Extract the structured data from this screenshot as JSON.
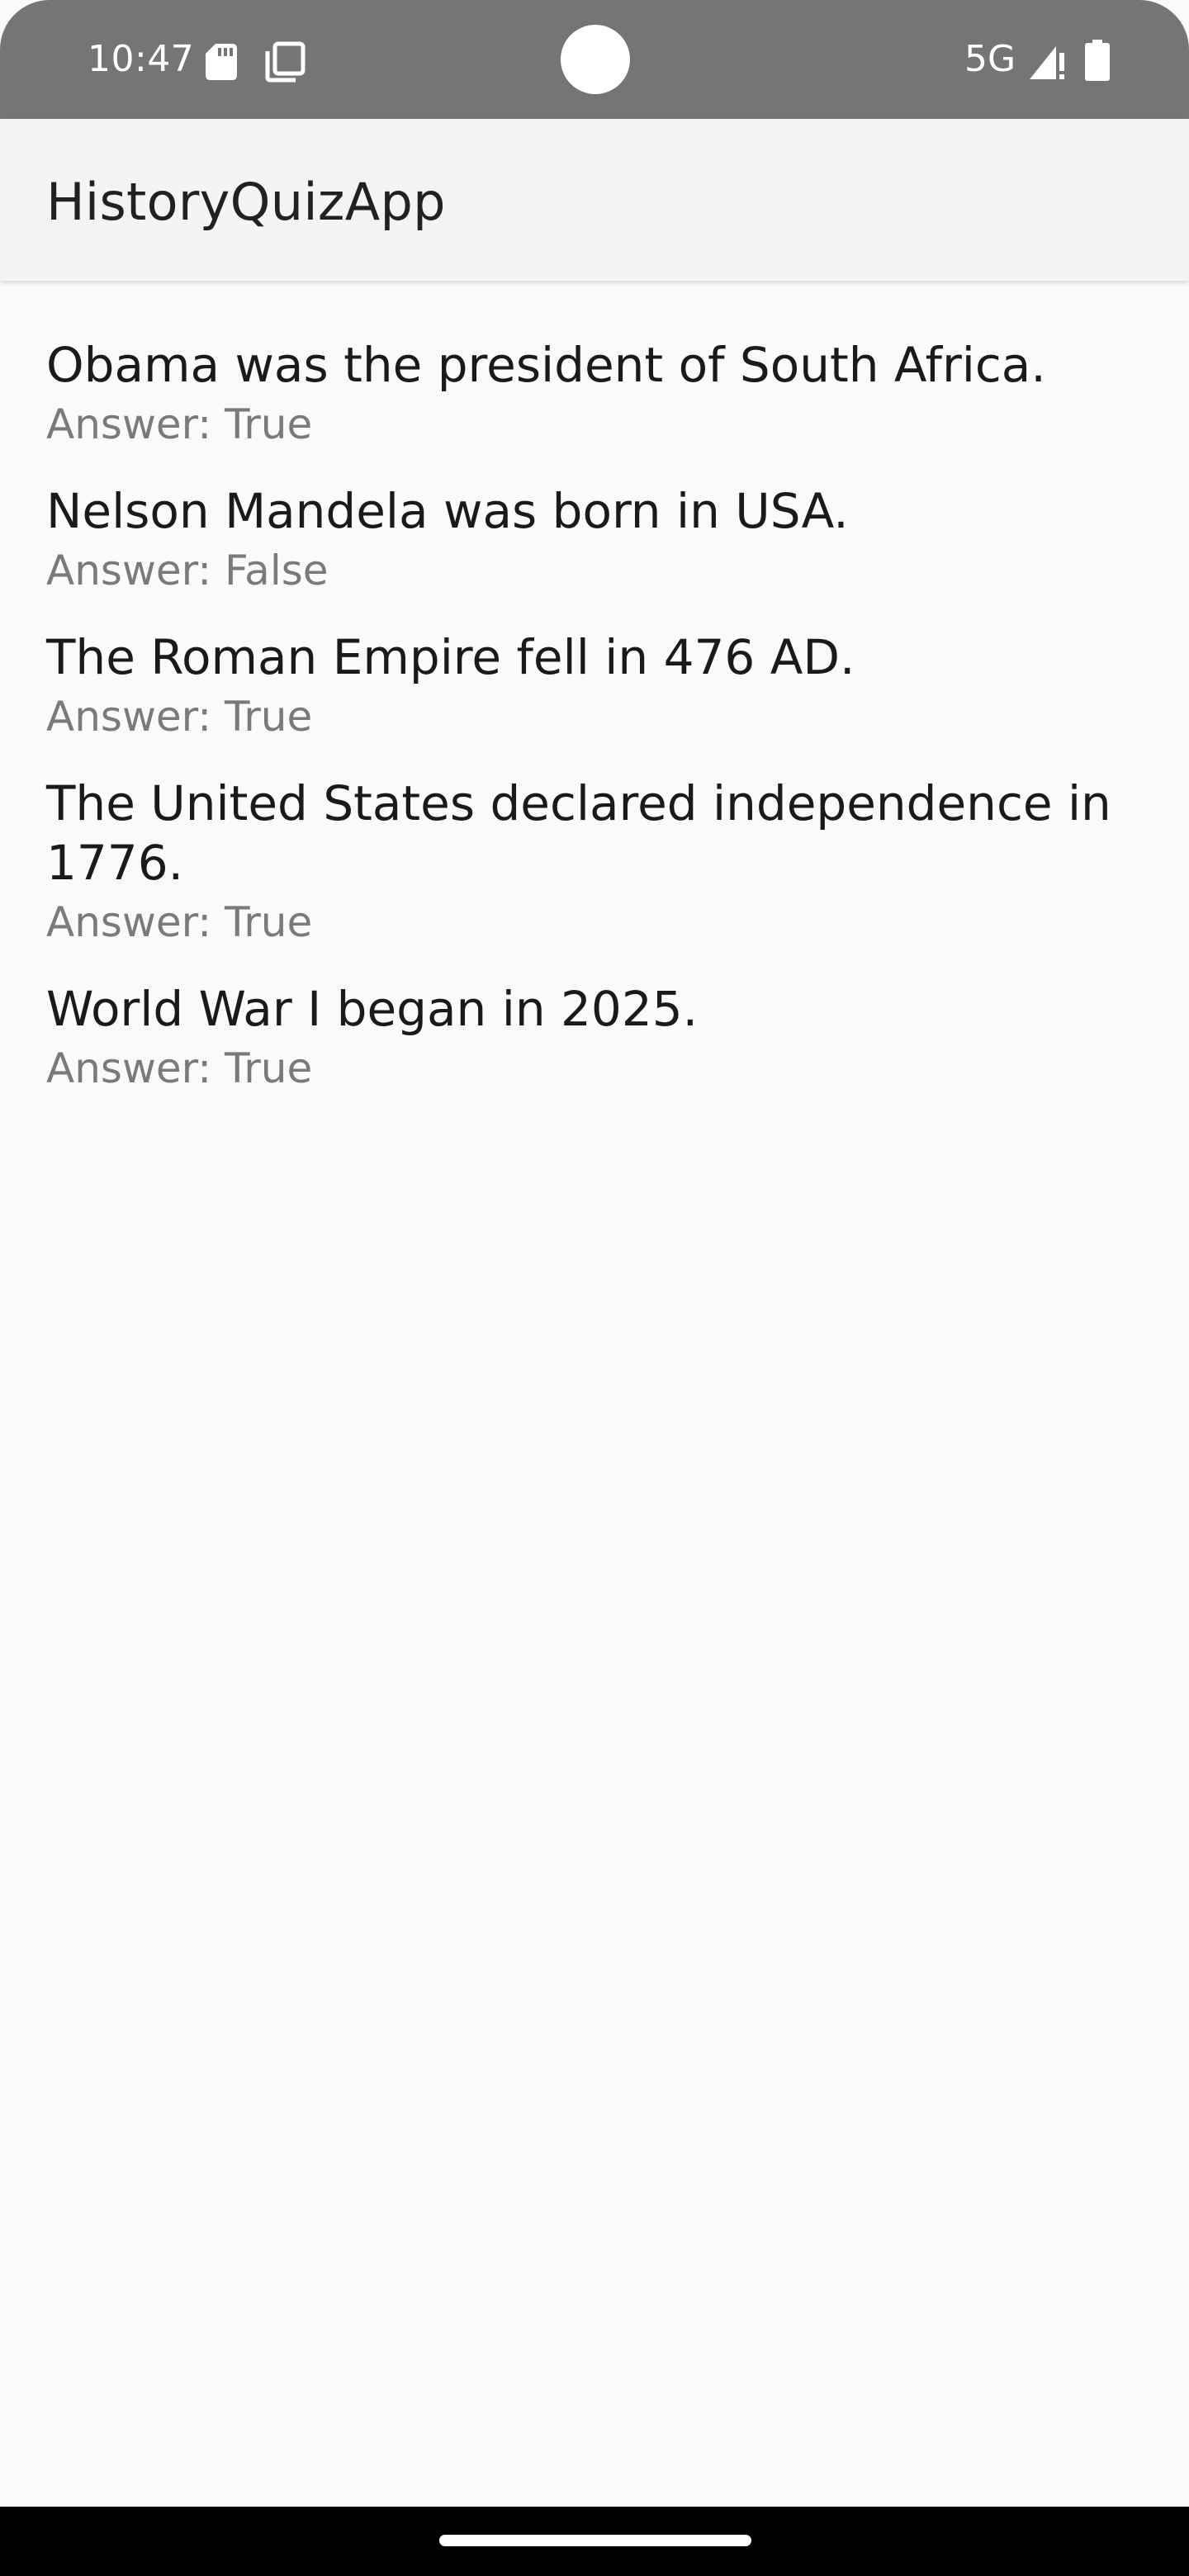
{
  "status_bar": {
    "time": "10:47",
    "network": "5G",
    "icons": [
      "sd-card-icon",
      "copy-icon",
      "signal-icon",
      "battery-icon"
    ]
  },
  "app_bar": {
    "title": "HistoryQuizApp"
  },
  "quiz": {
    "items": [
      {
        "question": "Obama was the president of South Africa.",
        "answer": "Answer: True"
      },
      {
        "question": "Nelson Mandela was born in USA.",
        "answer": "Answer: False"
      },
      {
        "question": "The Roman Empire fell in 476 AD.",
        "answer": "Answer: True"
      },
      {
        "question": "The United States declared independence in 1776.",
        "answer": "Answer: True"
      },
      {
        "question": "World War I began in 2025.",
        "answer": "Answer: True"
      }
    ]
  },
  "colors": {
    "status_bar": "#757575",
    "app_bar": "#f4f4f4",
    "background": "#fafafa",
    "question_text": "#1a1a1a",
    "answer_text": "#7a7a7a",
    "nav_bar": "#000000"
  }
}
